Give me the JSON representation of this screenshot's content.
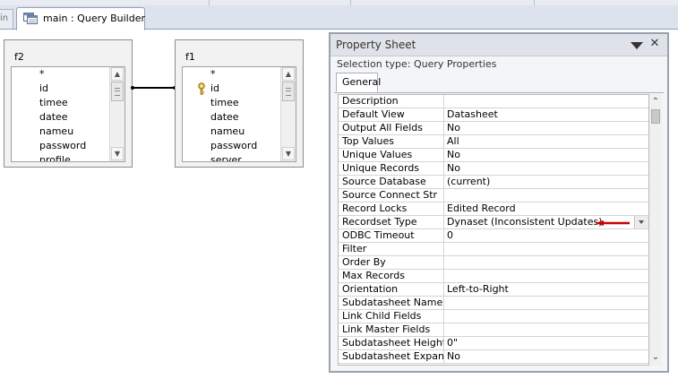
{
  "tabs": {
    "previous_label": "in",
    "active_label": "main : Query Builder"
  },
  "design_tables": [
    {
      "title": "f2",
      "fields": [
        "*",
        "id",
        "timee",
        "datee",
        "nameu",
        "password",
        "profile"
      ],
      "key_field_index": null
    },
    {
      "title": "f1",
      "fields": [
        "*",
        "id",
        "timee",
        "datee",
        "nameu",
        "password",
        "server"
      ],
      "key_field_index": 1
    }
  ],
  "property_sheet": {
    "title": "Property Sheet",
    "selection_type_label": "Selection type:",
    "selection_type_value": "Query Properties",
    "tab_label": "General",
    "annotation_color": "#cc0000",
    "properties": [
      {
        "name": "Description",
        "value": ""
      },
      {
        "name": "Default View",
        "value": "Datasheet"
      },
      {
        "name": "Output All Fields",
        "value": "No"
      },
      {
        "name": "Top Values",
        "value": "All"
      },
      {
        "name": "Unique Values",
        "value": "No"
      },
      {
        "name": "Unique Records",
        "value": "No"
      },
      {
        "name": "Source Database",
        "value": "(current)"
      },
      {
        "name": "Source Connect Str",
        "value": ""
      },
      {
        "name": "Record Locks",
        "value": "Edited Record"
      },
      {
        "name": "Recordset Type",
        "value": "Dynaset (Inconsistent Updates)"
      },
      {
        "name": "ODBC Timeout",
        "value": "0"
      },
      {
        "name": "Filter",
        "value": ""
      },
      {
        "name": "Order By",
        "value": ""
      },
      {
        "name": "Max Records",
        "value": ""
      },
      {
        "name": "Orientation",
        "value": "Left-to-Right"
      },
      {
        "name": "Subdatasheet Name",
        "value": ""
      },
      {
        "name": "Link Child Fields",
        "value": ""
      },
      {
        "name": "Link Master Fields",
        "value": ""
      },
      {
        "name": "Subdatasheet Height",
        "value": "0\""
      },
      {
        "name": "Subdatasheet Expand",
        "value": "No"
      }
    ]
  }
}
